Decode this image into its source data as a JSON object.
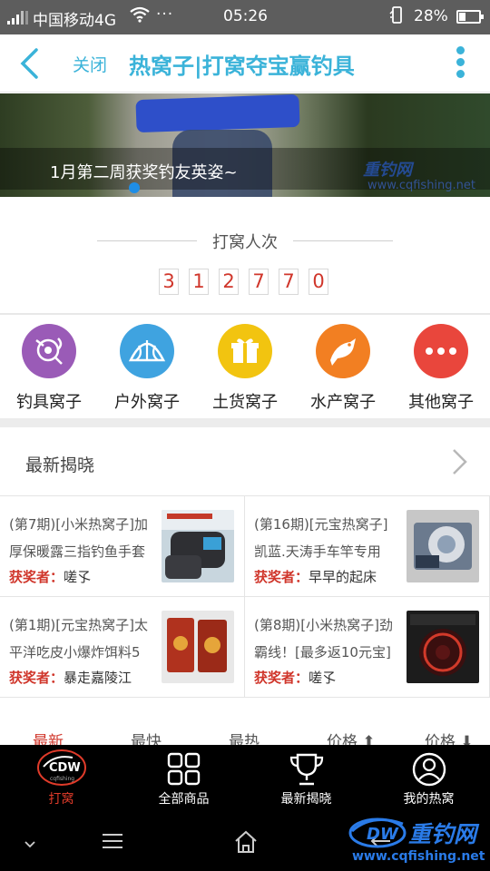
{
  "status_bar": {
    "carrier": "中国移动4G",
    "dots": "···",
    "time": "05:26",
    "battery_percent": "28%"
  },
  "header": {
    "close_label": "关闭",
    "title": "热窝子|打窝夺宝赢钓具"
  },
  "banner": {
    "caption": "1月第二周获奖钓友英姿~",
    "watermark": "重钓网",
    "watermark_url": "www.cqfishing.net"
  },
  "counter": {
    "label": "打窝人次",
    "digits": [
      "3",
      "1",
      "2",
      "7",
      "7",
      "0"
    ]
  },
  "categories": [
    {
      "label": "钓具窝子",
      "icon": "fishing-gear-icon",
      "color": "#9a5bb7"
    },
    {
      "label": "户外窝子",
      "icon": "tent-icon",
      "color": "#3fa3e0"
    },
    {
      "label": "土货窝子",
      "icon": "gift-icon",
      "color": "#f2c410"
    },
    {
      "label": "水产窝子",
      "icon": "fish-icon",
      "color": "#f27f22"
    },
    {
      "label": "其他窝子",
      "icon": "more-dots-icon",
      "color": "#e9463c"
    }
  ],
  "latest": {
    "title": "最新揭晓",
    "winner_key": "获奖者：",
    "items": [
      {
        "title": "(第7期)[小米热窝子]加厚保暖露三指钓鱼手套",
        "winner": "嗟孓"
      },
      {
        "title": "(第16期)[元宝热窝子]凯蓝.天涛手车竿专用",
        "winner": "早早的起床"
      },
      {
        "title": "(第1期)[元宝热窝子]太平洋吃皮小爆炸饵料5",
        "winner": "暴走嘉陵江"
      },
      {
        "title": "(第8期)[小米热窝子]劲霸线！[最多返10元宝]",
        "winner": "嗟孓"
      }
    ]
  },
  "sort_bar": {
    "items": [
      "最新",
      "最快",
      "最热",
      "价格 ⬆",
      "价格 ⬇"
    ]
  },
  "bottom_nav": [
    {
      "label": "打窝",
      "icon": "logo-icon"
    },
    {
      "label": "全部商品",
      "icon": "grid-icon"
    },
    {
      "label": "最新揭晓",
      "icon": "trophy-icon"
    },
    {
      "label": "我的热窝",
      "icon": "user-icon"
    }
  ],
  "watermark": {
    "brand": "重钓网",
    "url": "www.cqfishing.net"
  },
  "colors": {
    "accent": "#3bb3d9",
    "red": "#d0362b",
    "status_bar": "#5d5d5d"
  }
}
